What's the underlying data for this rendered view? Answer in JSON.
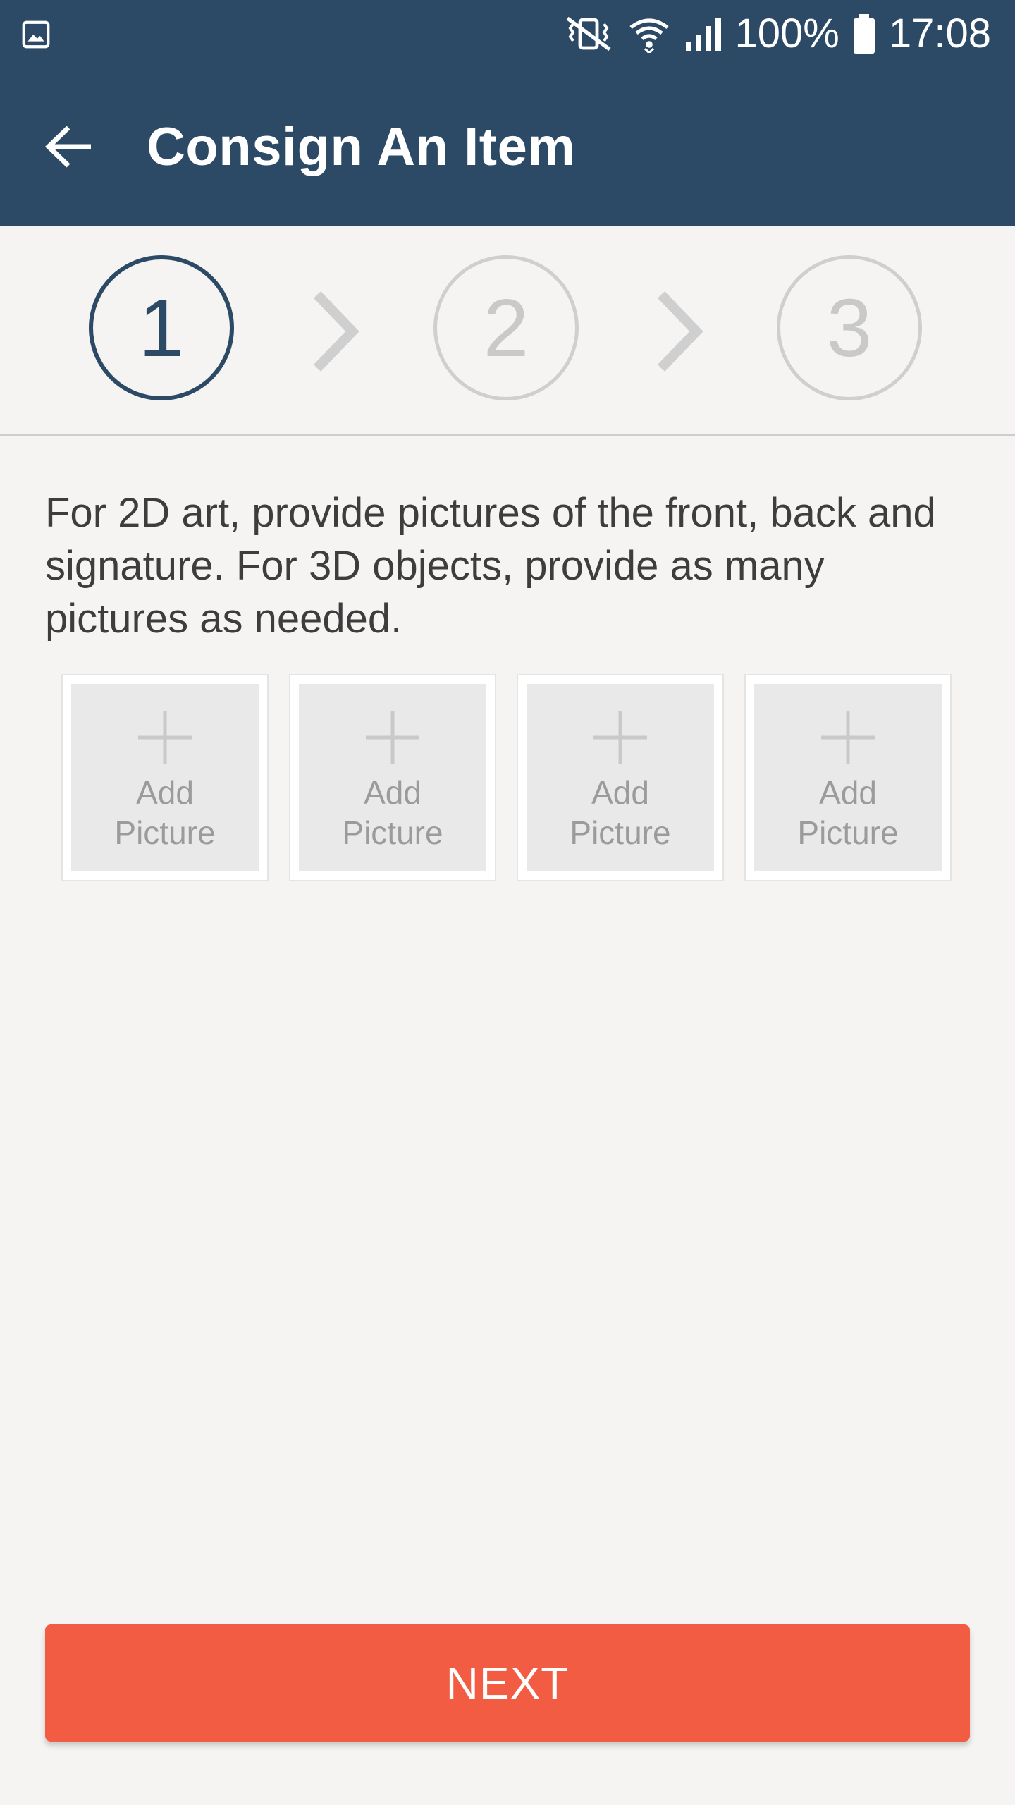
{
  "status_bar": {
    "battery_percent": "100%",
    "time": "17:08",
    "icons": [
      "gallery-icon",
      "mute-vibrate-icon",
      "wifi-icon",
      "signal-icon",
      "battery-icon"
    ]
  },
  "app_bar": {
    "title": "Consign An Item",
    "back_icon": "arrow-back-icon"
  },
  "stepper": {
    "current_step": 1,
    "steps": [
      {
        "label": "1",
        "state": "active"
      },
      {
        "label": "2",
        "state": "inactive"
      },
      {
        "label": "3",
        "state": "inactive"
      }
    ],
    "separator_icon": "chevron-right-icon"
  },
  "instructions": {
    "text": "For 2D art, provide pictures of the front, back and signature. For 3D objects, provide as many pictures as needed."
  },
  "picture_slots": [
    {
      "label": "Add\nPicture",
      "icon": "plus-icon"
    },
    {
      "label": "Add\nPicture",
      "icon": "plus-icon"
    },
    {
      "label": "Add\nPicture",
      "icon": "plus-icon"
    },
    {
      "label": "Add\nPicture",
      "icon": "plus-icon"
    }
  ],
  "next_button": {
    "label": "NEXT"
  },
  "colors": {
    "primary": "#2c4a66",
    "accent": "#f25c42",
    "background": "#f5f4f2",
    "inactive": "#cfcfcf"
  }
}
